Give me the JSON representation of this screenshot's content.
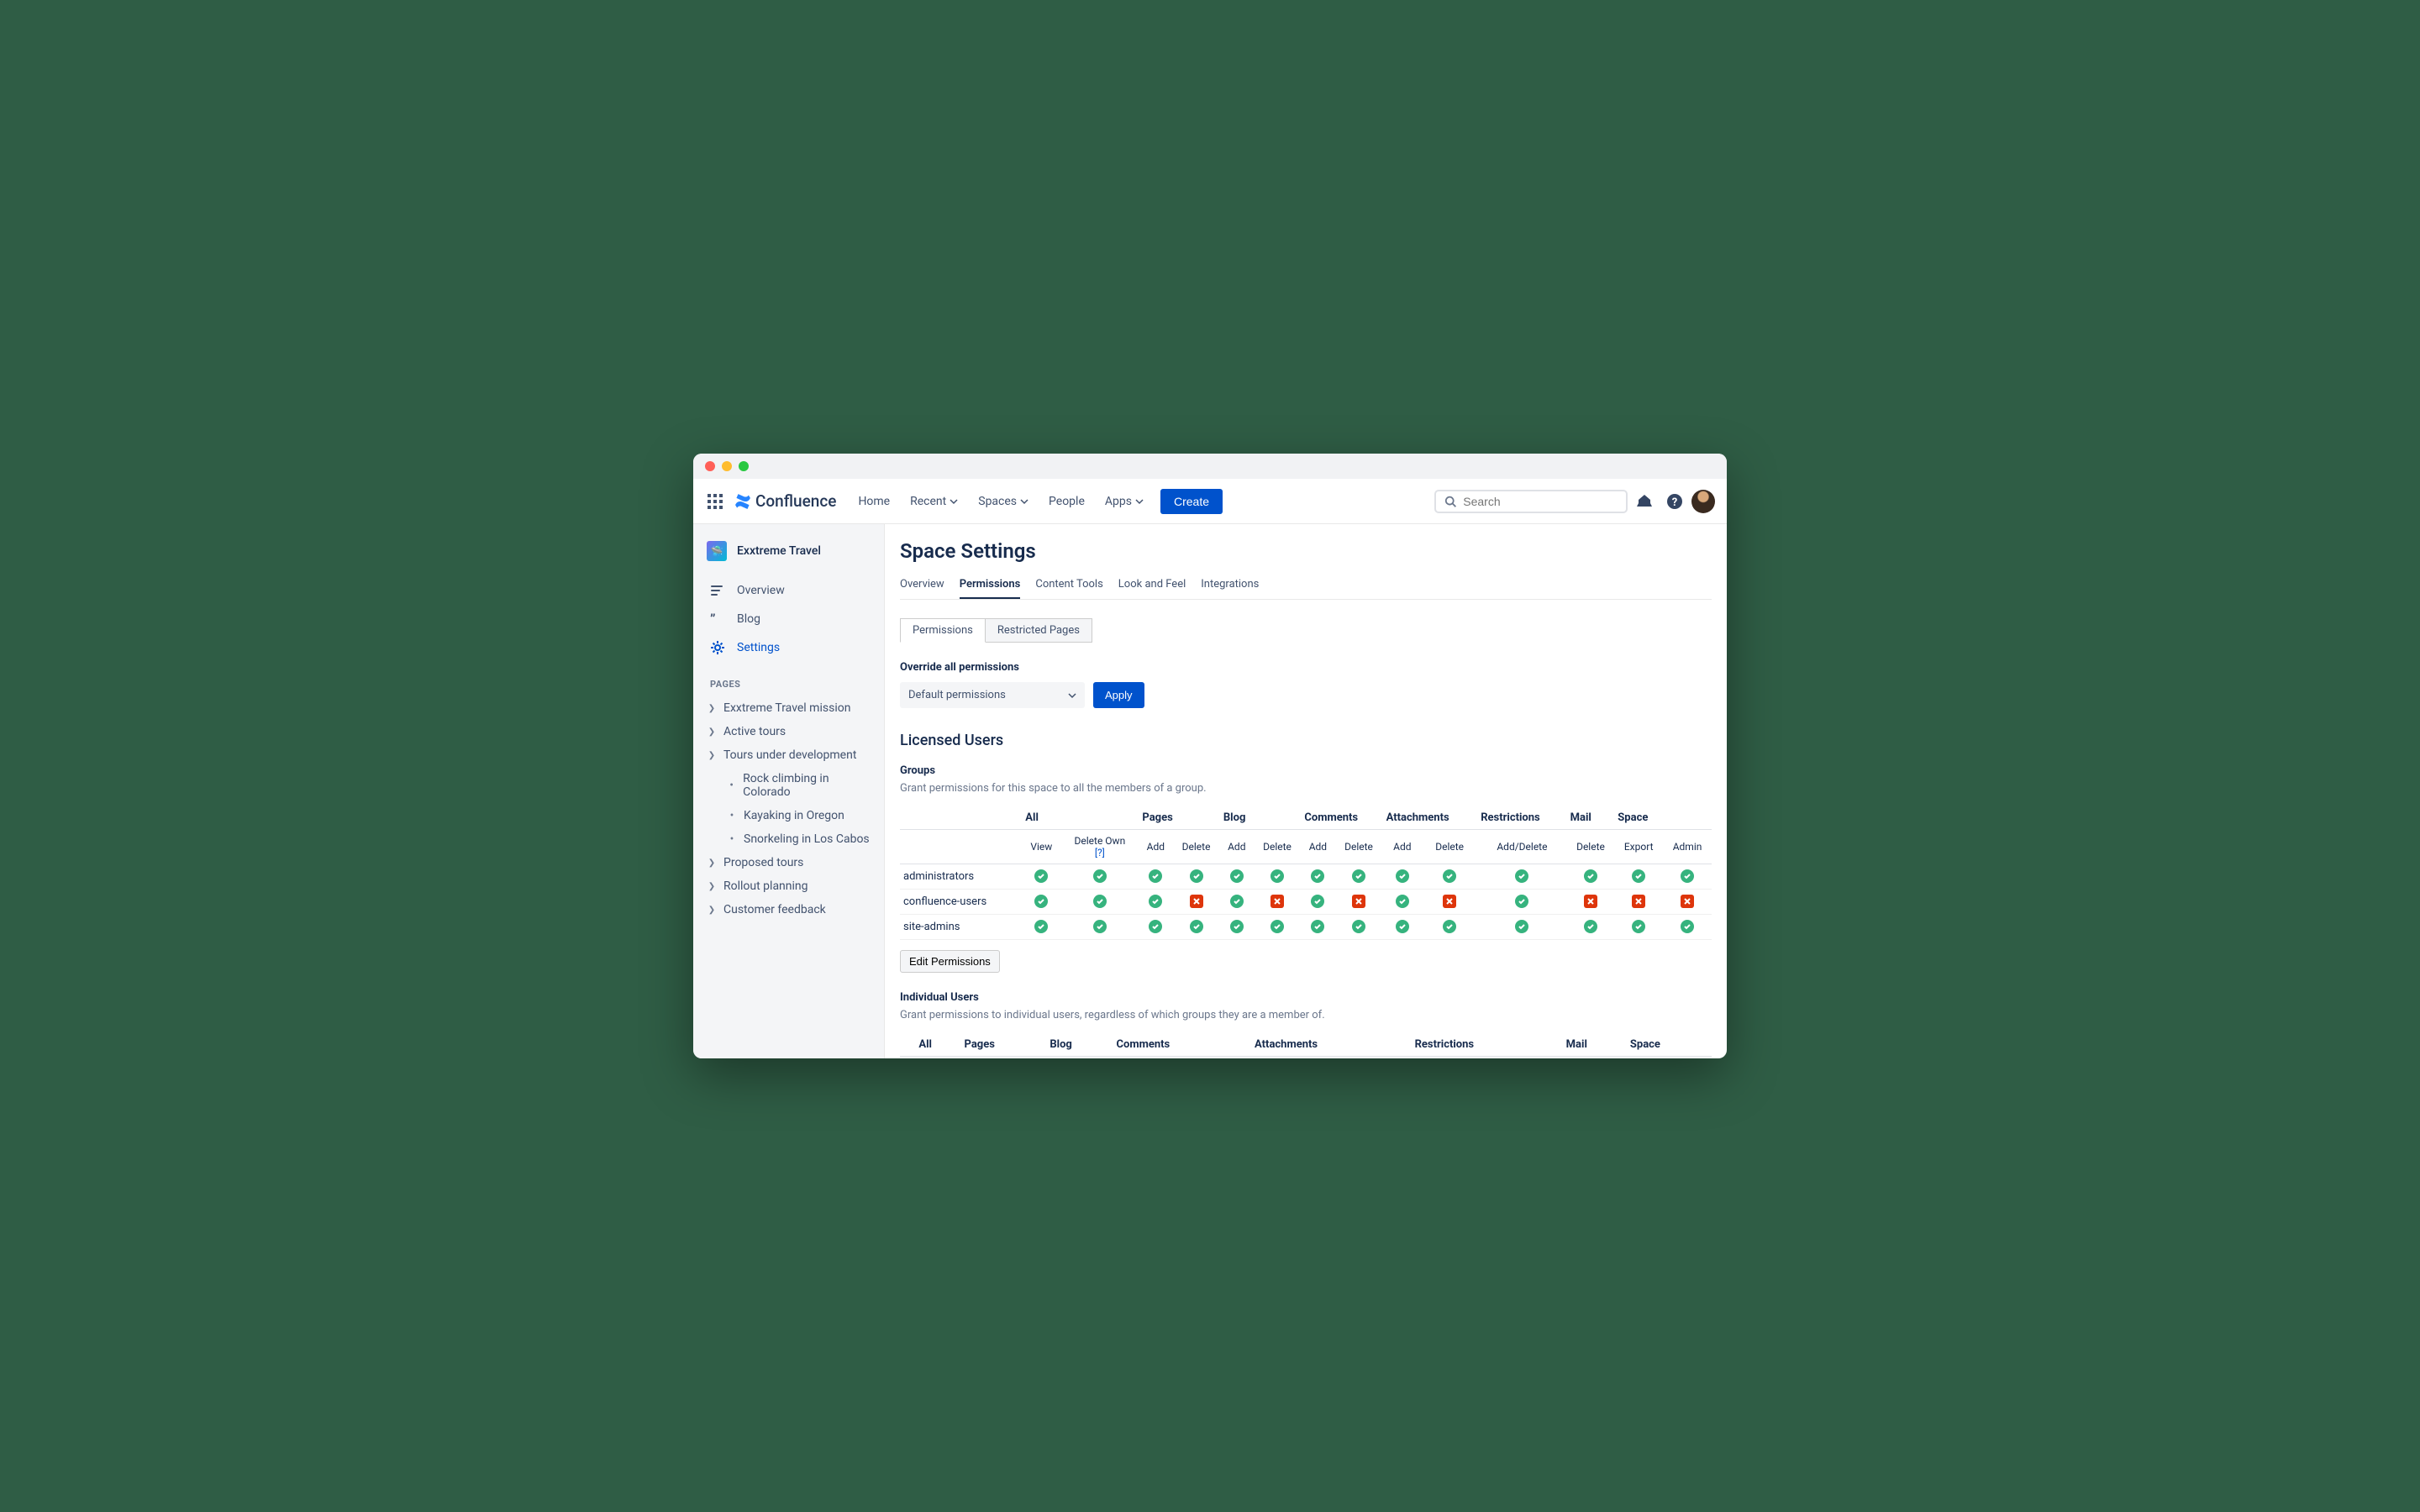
{
  "product": "Confluence",
  "nav": {
    "home": "Home",
    "recent": "Recent",
    "spaces": "Spaces",
    "people": "People",
    "apps": "Apps",
    "create": "Create"
  },
  "search": {
    "placeholder": "Search"
  },
  "space": {
    "name": "Exxtreme Travel"
  },
  "sidebar": {
    "overview": "Overview",
    "blog": "Blog",
    "settings": "Settings",
    "pages_label": "PAGES",
    "tree": {
      "p0": "Exxtreme Travel mission",
      "p1": "Active tours",
      "p2": "Tours under development",
      "p2c0": "Rock climbing in Colorado",
      "p2c1": "Kayaking in Oregon",
      "p2c2": "Snorkeling in Los Cabos",
      "p3": "Proposed tours",
      "p4": "Rollout planning",
      "p5": "Customer feedback"
    }
  },
  "page": {
    "title": "Space Settings",
    "tabs": {
      "overview": "Overview",
      "permissions": "Permissions",
      "content_tools": "Content Tools",
      "look_and_feel": "Look and Feel",
      "integrations": "Integrations"
    },
    "subtabs": {
      "permissions": "Permissions",
      "restricted": "Restricted Pages"
    },
    "override_title": "Override all permissions",
    "override_select": "Default permissions",
    "apply": "Apply",
    "licensed_title": "Licensed Users",
    "groups_title": "Groups",
    "groups_desc": "Grant permissions for this space to all the members of a group.",
    "cols": {
      "all": "All",
      "pages": "Pages",
      "blog": "Blog",
      "comments": "Comments",
      "attachments": "Attachments",
      "restrictions": "Restrictions",
      "mail": "Mail",
      "space": "Space"
    },
    "subcols": {
      "view": "View",
      "delete_own": "Delete Own",
      "help": "[?]",
      "add": "Add",
      "delete": "Delete",
      "add_delete": "Add/Delete",
      "export": "Export",
      "admin": "Admin"
    },
    "groups": [
      {
        "name": "administrators",
        "p": [
          1,
          1,
          1,
          1,
          1,
          1,
          1,
          1,
          1,
          1,
          1,
          1,
          1,
          1
        ]
      },
      {
        "name": "confluence-users",
        "p": [
          1,
          1,
          1,
          0,
          1,
          0,
          1,
          0,
          1,
          0,
          1,
          0,
          0,
          0
        ]
      },
      {
        "name": "site-admins",
        "p": [
          1,
          1,
          1,
          1,
          1,
          1,
          1,
          1,
          1,
          1,
          1,
          1,
          1,
          1
        ]
      }
    ],
    "edit": "Edit Permissions",
    "individual_title": "Individual Users",
    "individual_desc": "Grant permissions to individual users, regardless of which groups they are a member of."
  }
}
